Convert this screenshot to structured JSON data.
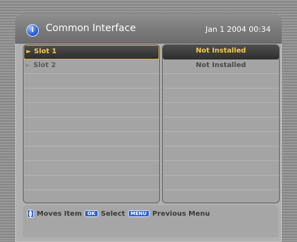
{
  "header": {
    "icon": "info-icon",
    "title": "Common Interface",
    "datetime": "Jan 1 2004 00:34"
  },
  "slots": [
    {
      "label": "Slot 1",
      "status": "Not Installed",
      "selected": true
    },
    {
      "label": "Slot 2",
      "status": "Not Installed",
      "selected": false
    }
  ],
  "footer": {
    "move_icon": "up-down-arrows-icon",
    "move_label": "Moves Item",
    "ok_key": "OK",
    "ok_label": "Select",
    "menu_key": "MENU",
    "menu_label": "Previous Menu"
  },
  "colors": {
    "highlight_text": "#f5c94a",
    "highlight_border": "#e2b33b",
    "key_blue": "#2e63c9"
  }
}
